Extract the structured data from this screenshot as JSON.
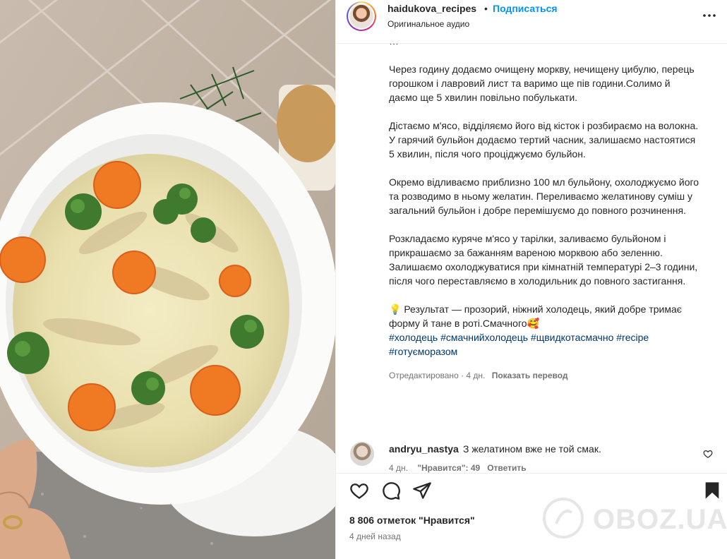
{
  "header": {
    "username": "haidukova_recipes",
    "separator": "•",
    "follow_label": "Подписаться",
    "audio": "Оригинальное аудио",
    "more_icon": "more-horizontal-icon"
  },
  "caption": {
    "partial_top": "…",
    "paragraphs": [
      "Через годину додаємо очищену моркву, нечищену цибулю, перець горошком і лавровий лист та варимо ще пів години.Солимо й даємо ще 5 хвилин повільно побулькати.",
      "Дістаємо м'ясо, відділяємо його від кісток і розбираємо на волокна. У гарячий бульйон додаємо тертий часник, залишаємо настоятися 5 хвилин, після чого проціджуємо бульйон.",
      "Окремо відливаємо приблизно 100 мл бульйону, охолоджуємо його та розводимо в ньому желатин. Переливаємо желатинову суміш у загальний бульйон і добре перемішуємо до повного розчинення.",
      "Розкладаємо куряче м'ясо у тарілки, заливаємо бульйоном і прикрашаємо за бажанням вареною морквою або зеленню. Залишаємо охолоджуватися при кімнатній температурі 2–3 години, після чого переставляємо в холодильник до повного застигання.",
      "💡  Результат — прозорий, ніжний холодець, який добре тримає форму й тане в роті.Смачного🥰"
    ],
    "hashtags": "#холодець #смачнийхолодець #щвидкотасмачно #recipe #готуєморазом",
    "edited_meta": "Отредактировано · 4 дн.",
    "translate_label": "Показать перевод"
  },
  "comment": {
    "username": "andryu_nastya",
    "text": "З желатином вже не той смак.",
    "age": "4 дн.",
    "likes_text": "\"Нравится\": 49",
    "reply_label": "Ответить",
    "heart_icon": "heart-outline-icon"
  },
  "actions": {
    "icons": [
      "heart-icon",
      "comment-icon",
      "share-icon",
      "bookmark-icon"
    ],
    "likes": "8 806 отметок \"Нравится\"",
    "ago": "4 дней назад"
  },
  "watermark": {
    "text": "OBOZ.UA"
  },
  "colors": {
    "accent": "#0095f6",
    "hashtag": "#00376b",
    "secondary_text": "#737373",
    "text": "#262626"
  }
}
